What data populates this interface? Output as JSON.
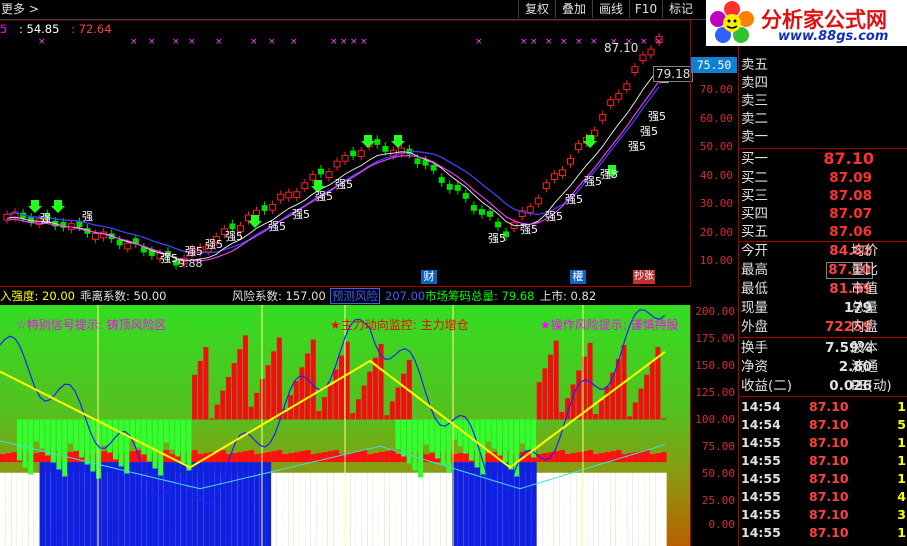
{
  "toolbar": {
    "more": "更多",
    "more_arrow": ">",
    "buttons": [
      "复权",
      "叠加",
      "画线",
      "F10",
      "标记"
    ]
  },
  "brand": {
    "name": "分析家公式网",
    "url": "www.88gs.com"
  },
  "main_header": {
    "a": "5",
    "b": ": 54.85",
    "c": ": 72.64"
  },
  "price_axis": {
    "ticks": [
      "70.00",
      "60.00",
      "50.00",
      "40.00",
      "30.00",
      "20.00",
      "10.00"
    ],
    "current": "75.50"
  },
  "main_labels": {
    "high_label": "87.10",
    "low_label": "9.88",
    "side_label": "79.18",
    "markers": [
      "财",
      "權",
      "抄张"
    ],
    "strong": "强5",
    "strong_short": "强"
  },
  "indicator_bar": [
    {
      "text": "入强度: 20.00",
      "color": "#ffff00"
    },
    {
      "text": "乖离系数: 50.00",
      "color": "#e0e0e0"
    },
    {
      "text": "风险系数: 157.00",
      "color": "#e0e0e0"
    },
    {
      "text": "预测风险",
      "color": "#4040ff",
      "boxed": true
    },
    {
      "text": "207.00",
      "color": "#4040ff"
    },
    {
      "text": "市场筹码总量: 79.68",
      "color": "#00ff00"
    },
    {
      "text": "上市: 0.82",
      "color": "#e0e0e0"
    }
  ],
  "indicator_notes": [
    {
      "text": "☆特别信号提示: 铸顶风险区",
      "color": "#ff00ff"
    },
    {
      "text": "★主力动向监控: 主力增仓",
      "color": "#ff0000"
    },
    {
      "text": "★操作风险提示: 谨慎持股",
      "color": "#ff00ff"
    }
  ],
  "indicator_axis": {
    "ticks": [
      "200.00",
      "175.00",
      "150.00",
      "125.00",
      "100.00",
      "75.00",
      "50.00",
      "25.00",
      "0.00"
    ]
  },
  "order_book": {
    "sell": [
      {
        "label": "卖五"
      },
      {
        "label": "卖四"
      },
      {
        "label": "卖三"
      },
      {
        "label": "卖二"
      },
      {
        "label": "卖一"
      }
    ],
    "buy": [
      {
        "label": "买一",
        "price": "87.10"
      },
      {
        "label": "买二",
        "price": "87.09"
      },
      {
        "label": "买三",
        "price": "87.08"
      },
      {
        "label": "买四",
        "price": "87.07"
      },
      {
        "label": "买五",
        "price": "87.06"
      }
    ]
  },
  "quote": [
    {
      "l": "今开",
      "v": "84.82",
      "c": "#ff4040",
      "r": "均价"
    },
    {
      "l": "最高",
      "v": "87.10",
      "c": "#ff4040",
      "r": "量比",
      "boxed": true
    },
    {
      "l": "最低",
      "v": "81.99",
      "c": "#ff4040",
      "r": "市值"
    },
    {
      "l": "现量",
      "v": "179",
      "c": "#e0e0e0",
      "r": "总量"
    },
    {
      "l": "外盘",
      "v": "72259",
      "c": "#ff4040",
      "r": "内盘"
    }
  ],
  "stats": [
    {
      "l": "换手",
      "v": "7.59%",
      "c": "#e0e0e0",
      "r": "股本"
    },
    {
      "l": "净资",
      "v": "2.80",
      "c": "#e0e0e0",
      "r": "流通"
    },
    {
      "l": "收益(二)",
      "v": "0.026",
      "c": "#e0e0e0",
      "r": "PE(动)"
    }
  ],
  "ticks": [
    {
      "t": "14:54",
      "p": "87.10",
      "v": "1"
    },
    {
      "t": "14:54",
      "p": "87.10",
      "v": "5"
    },
    {
      "t": "14:55",
      "p": "87.10",
      "v": "1"
    },
    {
      "t": "14:55",
      "p": "87.10",
      "v": "1"
    },
    {
      "t": "14:55",
      "p": "87.10",
      "v": "1"
    },
    {
      "t": "14:55",
      "p": "87.10",
      "v": "4"
    },
    {
      "t": "14:55",
      "p": "87.10",
      "v": "3"
    },
    {
      "t": "14:55",
      "p": "87.10",
      "v": "1"
    }
  ],
  "colors": {
    "up": "#ff2020",
    "down": "#00ff00",
    "axis": "#aa0000",
    "ind_bg": "#20d020",
    "ind_bg2": "#b06000"
  }
}
